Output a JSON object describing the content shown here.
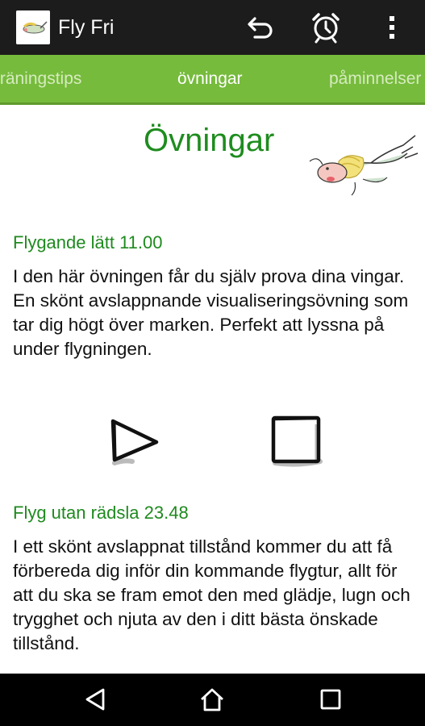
{
  "app": {
    "title": "Fly Fri"
  },
  "tabs": [
    {
      "label": "träningstips",
      "active": false
    },
    {
      "label": "övningar",
      "active": true
    },
    {
      "label": "påminnelser",
      "active": false
    }
  ],
  "page": {
    "title": "Övningar"
  },
  "tracks": [
    {
      "title": "Flygande lätt 11.00",
      "description": "I den här övningen får du själv prova dina vingar. En skönt avslappnande visualiseringsövning som tar dig högt över marken. Perfekt att lyssna på under flygningen."
    },
    {
      "title": "Flyg utan rädsla 23.48",
      "description": "I ett skönt avslappnat tillstånd kommer du att få förbereda dig inför din kommande flygtur, allt för att du ska se fram emot den med glädje, lugn och trygghet och njuta av den i ditt bästa önskade tillstånd."
    }
  ],
  "icons": {
    "undo": "undo-icon",
    "alarm": "alarm-clock-icon",
    "overflow": "overflow-menu-icon",
    "play": "play-icon",
    "stop": "stop-icon",
    "back": "back-icon",
    "home": "home-icon",
    "recents": "recents-icon"
  },
  "colors": {
    "actionbar": "#1c1c1c",
    "tabbar": "#76bb3c",
    "title_green": "#1e8c1e",
    "navbar": "#000000"
  }
}
